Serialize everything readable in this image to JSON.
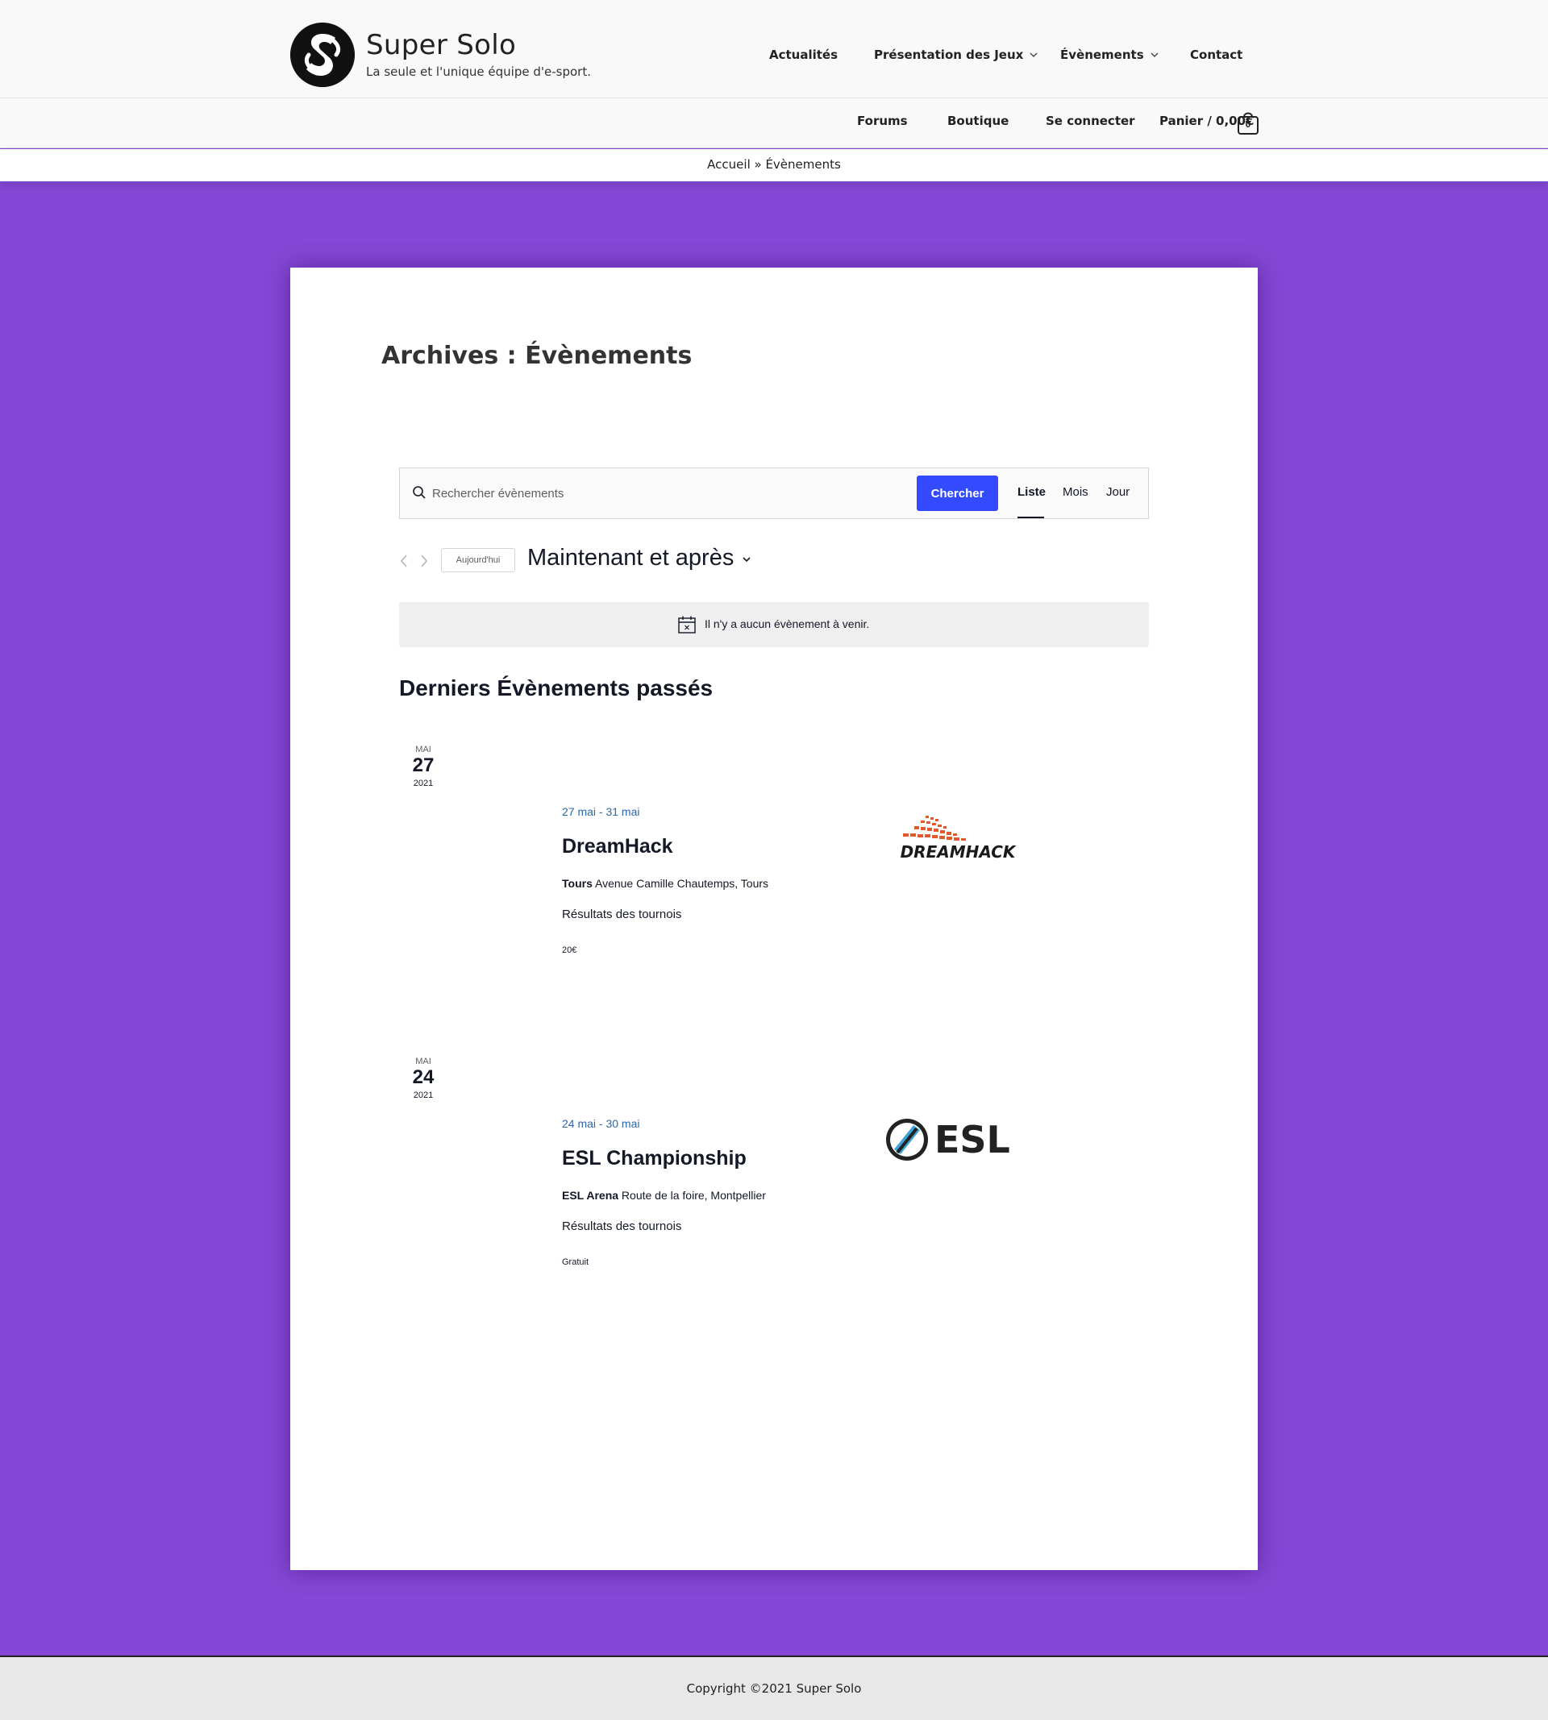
{
  "site": {
    "title": "Super Solo",
    "tagline": "La seule et l'unique équipe d'e-sport.",
    "logo_icon": "ss-monogram-logo"
  },
  "nav_main": [
    {
      "label": "Actualités",
      "has_dropdown": false
    },
    {
      "label": "Présentation des Jeux",
      "has_dropdown": true
    },
    {
      "label": "Évènements",
      "has_dropdown": true
    },
    {
      "label": "Contact",
      "has_dropdown": false
    }
  ],
  "nav_secondary": [
    {
      "label": "Forums"
    },
    {
      "label": "Boutique"
    },
    {
      "label": "Se connecter"
    }
  ],
  "cart": {
    "label": "Panier / 0,00€",
    "count": "0",
    "icon": "shopping-bag-icon"
  },
  "breadcrumb": "Accueil » Évènements",
  "page_title": "Archives : Évènements",
  "event_bar": {
    "search_placeholder": "Rechercher évènements",
    "search_button": "Chercher",
    "views": [
      "Liste",
      "Mois",
      "Jour"
    ],
    "active_view": "Liste",
    "today_button": "Aujourd'hui",
    "date_range": "Maintenant et après"
  },
  "notice": "Il n'y a aucun évènement à venir.",
  "past_heading": "Derniers Évènements passés",
  "events": [
    {
      "month": "Mai",
      "day": "27",
      "year": "2021",
      "dates": "27 mai - 31 mai",
      "title": "DreamHack",
      "venue_name": "Tours",
      "venue_address": "Avenue Camille Chautemps, Tours",
      "description": "Résultats des tournois",
      "cost": "20€",
      "logo": "DREAMHACK"
    },
    {
      "month": "Mai",
      "day": "24",
      "year": "2021",
      "dates": "24 mai - 30 mai",
      "title": "ESL Championship",
      "venue_name": "ESL Arena",
      "venue_address": "Route de la foire, Montpellier",
      "description": "Résultats des tournois",
      "cost": "Gratuit",
      "logo": "ESL"
    }
  ],
  "footer": "Copyright ©2021 Super Solo",
  "colors": {
    "page_background": "#8447d6",
    "accent_button": "#334aff",
    "event_date_link": "#2d67a8",
    "dreamhack_orange": "#e2592b",
    "esl_blue": "#3aa3d8"
  }
}
